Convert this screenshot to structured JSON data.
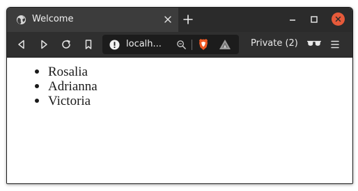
{
  "tab": {
    "title": "Welcome",
    "icon": "globe-icon"
  },
  "toolbar": {
    "url_display": "localh...",
    "private_label": "Private (2)"
  },
  "content": {
    "list_items": [
      "Rosalia",
      "Adrianna",
      "Victoria"
    ]
  },
  "colors": {
    "titlebar": "#2b2b2b",
    "active_tab": "#3c3c3c",
    "toolbar": "#2f2f2f",
    "urlbar": "#1c1c1c",
    "close_button": "#e65a3a",
    "brave_orange": "#f05a24"
  }
}
